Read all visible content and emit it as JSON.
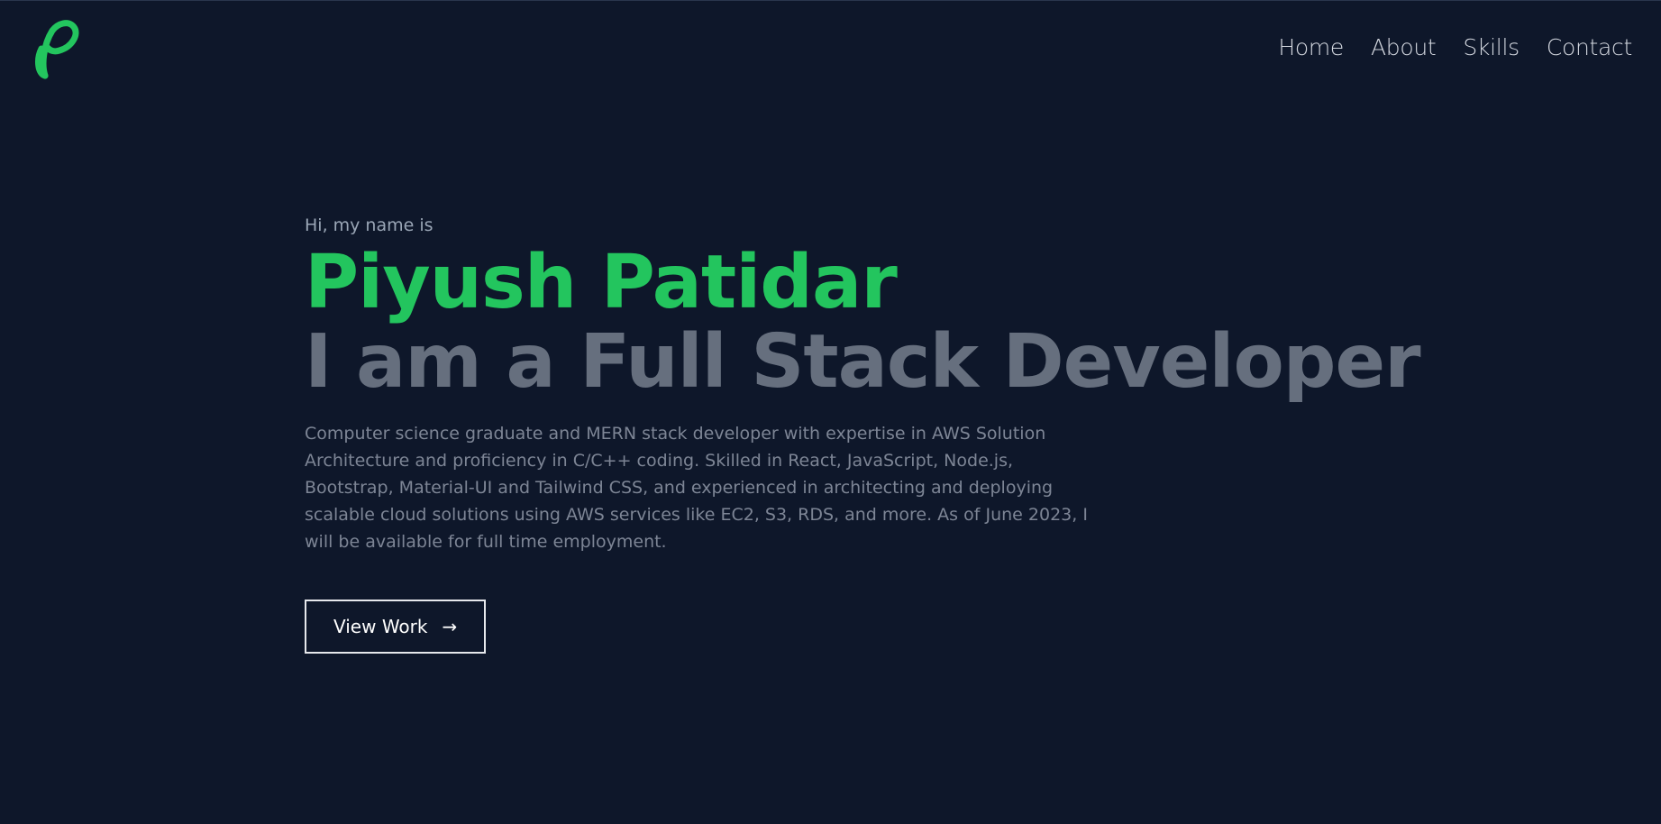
{
  "nav": {
    "logo_icon": "script-letter-p-logo",
    "links": [
      "Home",
      "About",
      "Skills",
      "Contact"
    ]
  },
  "hero": {
    "greeting": "Hi, my name is",
    "name": "Piyush Patidar",
    "role": "I am a Full Stack Developer",
    "bio": "Computer science graduate and MERN stack developer with expertise in AWS Solution Architecture and proficiency in C/C++ coding. Skilled in React, JavaScript, Node.js, Bootstrap, Material-UI and Tailwind CSS, and experienced in architecting and deploying scalable cloud solutions using AWS services like EC2, S3, RDS, and more. As of June 2023, I will be available for full time employment.",
    "cta_label": "View Work",
    "cta_icon": "arrow-right-icon"
  },
  "colors": {
    "background": "#0e172a",
    "accent": "#23c55e",
    "role_text": "#666f7e",
    "body_text": "#7d8595",
    "nav_text": "#d4d8e0"
  }
}
